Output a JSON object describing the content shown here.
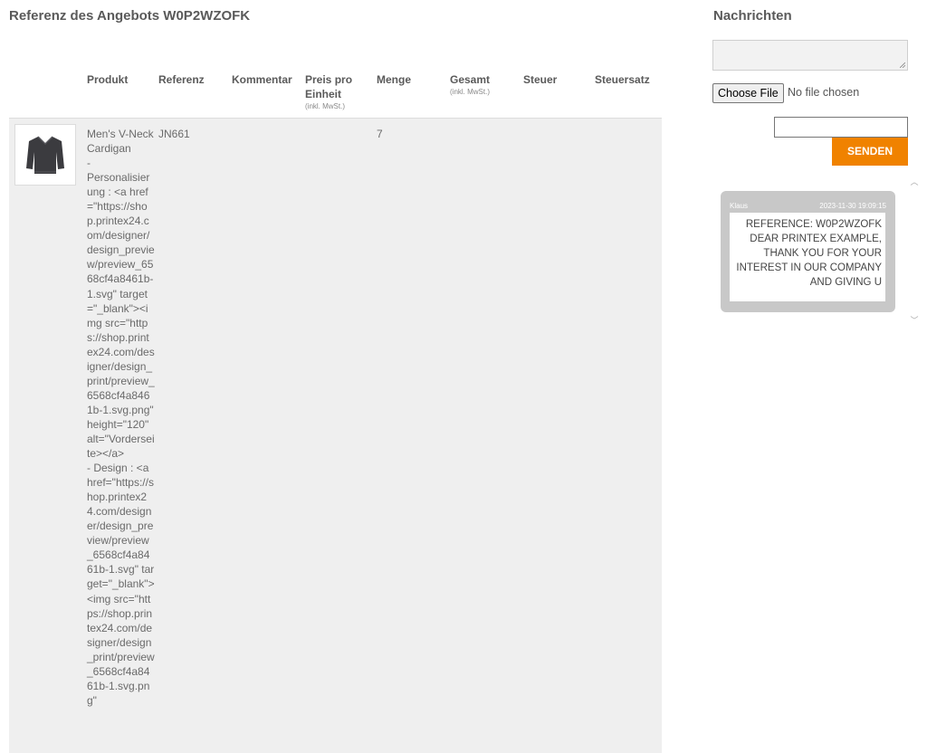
{
  "offer": {
    "title": "Referenz des Angebots W0P2WZOFK",
    "columns": {
      "product": "Produkt",
      "reference": "Referenz",
      "comment": "Kommentar",
      "unit_price": "Preis pro Einheit",
      "unit_price_note": "(inkl. MwSt.)",
      "quantity": "Menge",
      "total": "Gesamt",
      "total_note": "(inkl. MwSt.)",
      "tax": "Steuer",
      "tax_rate": "Steuersatz"
    },
    "rows": [
      {
        "product_description": "Men's V-Neck Cardigan\n-\nPersonalisierung : <a href=\"https://shop.printex24.com/designer/design_preview/preview_6568cf4a8461b-1.svg\" target=\"_blank\"><img src=\"https://shop.printex24.com/designer/design_print/preview_6568cf4a8461b-1.svg.png\" height=\"120\" alt=\"Vorderseite></a>\n- Design : <a href=\"https://shop.printex24.com/designer/design_preview/preview_6568cf4a8461b-1.svg\" target=\"_blank\"><img src=\"https://shop.printex24.com/designer/design_print/preview_6568cf4a8461b-1.svg.png\"",
        "reference": "JN661",
        "quantity": "7"
      }
    ]
  },
  "messages": {
    "title": "Nachrichten",
    "file_button": "Choose File",
    "file_status": "No file chosen",
    "send_button": "SENDEN",
    "items": [
      {
        "author": "Klaus",
        "timestamp": "2023-11-30 19:09:15",
        "text": "REFERENCE: W0P2WZOFK DEAR PRINTEX EXAMPLE, THANK YOU FOR YOUR INTEREST IN OUR COMPANY AND GIVING U"
      }
    ]
  },
  "colors": {
    "accent": "#f08200",
    "row_background": "#efefef",
    "bubble": "#c8c8c8"
  }
}
